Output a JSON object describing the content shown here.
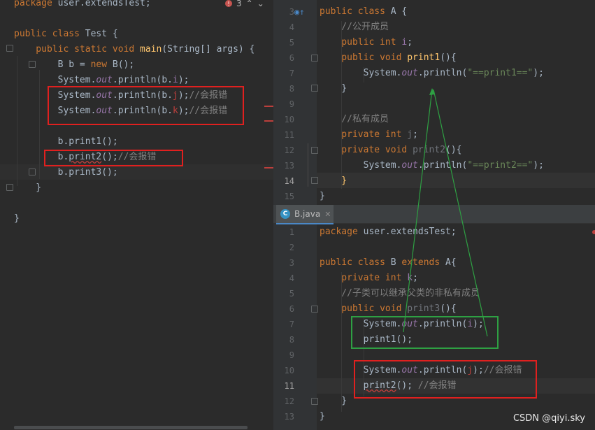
{
  "left": {
    "lines": [
      {
        "tokens": [
          {
            "t": "package ",
            "c": "kw"
          },
          {
            "t": "user.extendsTest;",
            "c": ""
          }
        ]
      },
      {
        "tokens": []
      },
      {
        "tokens": [
          {
            "t": "public class ",
            "c": "kw"
          },
          {
            "t": "Test {",
            "c": ""
          }
        ]
      },
      {
        "tokens": [
          {
            "t": "    public static void ",
            "c": "kw"
          },
          {
            "t": "main",
            "c": "fn"
          },
          {
            "t": "(String[] args) {",
            "c": ""
          }
        ]
      },
      {
        "tokens": [
          {
            "t": "        B b = ",
            "c": ""
          },
          {
            "t": "new ",
            "c": "kw"
          },
          {
            "t": "B();",
            "c": ""
          }
        ]
      },
      {
        "tokens": [
          {
            "t": "        System.",
            "c": ""
          },
          {
            "t": "out",
            "c": "static"
          },
          {
            "t": ".println(b.",
            "c": ""
          },
          {
            "t": "i",
            "c": "field"
          },
          {
            "t": ");",
            "c": ""
          }
        ]
      },
      {
        "tokens": [
          {
            "t": "        System.",
            "c": ""
          },
          {
            "t": "out",
            "c": "static"
          },
          {
            "t": ".println(b.",
            "c": ""
          },
          {
            "t": "j",
            "c": "err"
          },
          {
            "t": ");",
            "c": ""
          },
          {
            "t": "//会报错",
            "c": "cmt"
          }
        ]
      },
      {
        "tokens": [
          {
            "t": "        System.",
            "c": ""
          },
          {
            "t": "out",
            "c": "static"
          },
          {
            "t": ".println(b.",
            "c": ""
          },
          {
            "t": "k",
            "c": "err"
          },
          {
            "t": ");",
            "c": ""
          },
          {
            "t": "//会报错",
            "c": "cmt"
          }
        ]
      },
      {
        "tokens": []
      },
      {
        "tokens": [
          {
            "t": "        b.print1();",
            "c": ""
          }
        ]
      },
      {
        "tokens": [
          {
            "t": "        b.",
            "c": ""
          },
          {
            "t": "print2",
            "c": "wavy"
          },
          {
            "t": "();",
            "c": ""
          },
          {
            "t": "//会报错",
            "c": "cmt"
          }
        ]
      },
      {
        "tokens": [
          {
            "t": "        b.print3();",
            "c": ""
          }
        ]
      },
      {
        "tokens": [
          {
            "t": "    }",
            "c": ""
          }
        ]
      },
      {
        "tokens": []
      },
      {
        "tokens": [
          {
            "t": "}",
            "c": ""
          }
        ]
      }
    ],
    "problems_count": "3"
  },
  "right_top": {
    "line_numbers": [
      "3",
      "4",
      "5",
      "6",
      "7",
      "8",
      "9",
      "10",
      "11",
      "12",
      "13",
      "14",
      "15"
    ],
    "current_line": "14",
    "lines": [
      {
        "tokens": [
          {
            "t": "public class ",
            "c": "kw"
          },
          {
            "t": "A {",
            "c": ""
          }
        ]
      },
      {
        "tokens": [
          {
            "t": "    //公开成员",
            "c": "cmt"
          }
        ]
      },
      {
        "tokens": [
          {
            "t": "    public int ",
            "c": "kw"
          },
          {
            "t": "i",
            "c": "field"
          },
          {
            "t": ";",
            "c": ""
          }
        ]
      },
      {
        "tokens": [
          {
            "t": "    public void ",
            "c": "kw"
          },
          {
            "t": "print1",
            "c": "fn"
          },
          {
            "t": "(){",
            "c": ""
          }
        ]
      },
      {
        "tokens": [
          {
            "t": "        System.",
            "c": ""
          },
          {
            "t": "out",
            "c": "static"
          },
          {
            "t": ".println(",
            "c": ""
          },
          {
            "t": "\"==print1==\"",
            "c": "str"
          },
          {
            "t": ");",
            "c": ""
          }
        ]
      },
      {
        "tokens": [
          {
            "t": "    }",
            "c": ""
          }
        ]
      },
      {
        "tokens": []
      },
      {
        "tokens": [
          {
            "t": "    //私有成员",
            "c": "cmt"
          }
        ]
      },
      {
        "tokens": [
          {
            "t": "    private int ",
            "c": "kw"
          },
          {
            "t": "j",
            "c": "dim"
          },
          {
            "t": ";",
            "c": ""
          }
        ]
      },
      {
        "tokens": [
          {
            "t": "    private void ",
            "c": "kw"
          },
          {
            "t": "print2",
            "c": "dim"
          },
          {
            "t": "(){",
            "c": ""
          }
        ]
      },
      {
        "tokens": [
          {
            "t": "        System.",
            "c": ""
          },
          {
            "t": "out",
            "c": "static"
          },
          {
            "t": ".println(",
            "c": ""
          },
          {
            "t": "\"==print2==\"",
            "c": "str"
          },
          {
            "t": ");",
            "c": ""
          }
        ]
      },
      {
        "tokens": [
          {
            "t": "    }",
            "c": "fn"
          }
        ]
      },
      {
        "tokens": [
          {
            "t": "}",
            "c": ""
          }
        ]
      }
    ]
  },
  "right_bottom": {
    "tab_label": "B.java",
    "tab_icon_letter": "C",
    "line_numbers": [
      "1",
      "2",
      "3",
      "4",
      "5",
      "6",
      "7",
      "8",
      "9",
      "10",
      "11",
      "12",
      "13"
    ],
    "current_line": "11",
    "lines": [
      {
        "tokens": [
          {
            "t": "package ",
            "c": "kw"
          },
          {
            "t": "user.extendsTest;",
            "c": ""
          }
        ]
      },
      {
        "tokens": []
      },
      {
        "tokens": [
          {
            "t": "public class ",
            "c": "kw"
          },
          {
            "t": "B ",
            "c": ""
          },
          {
            "t": "extends ",
            "c": "kw"
          },
          {
            "t": "A{",
            "c": ""
          }
        ]
      },
      {
        "tokens": [
          {
            "t": "    private int ",
            "c": "kw"
          },
          {
            "t": "k",
            "c": "field"
          },
          {
            "t": ";",
            "c": ""
          }
        ]
      },
      {
        "tokens": [
          {
            "t": "    //子类可以继承父类的非私有成员",
            "c": "cmt"
          }
        ]
      },
      {
        "tokens": [
          {
            "t": "    public void ",
            "c": "kw"
          },
          {
            "t": "print3",
            "c": "dim"
          },
          {
            "t": "(){",
            "c": ""
          }
        ]
      },
      {
        "tokens": [
          {
            "t": "        System.",
            "c": ""
          },
          {
            "t": "out",
            "c": "static"
          },
          {
            "t": ".println(",
            "c": ""
          },
          {
            "t": "i",
            "c": "field"
          },
          {
            "t": ");",
            "c": ""
          }
        ]
      },
      {
        "tokens": [
          {
            "t": "        print1();",
            "c": ""
          }
        ]
      },
      {
        "tokens": []
      },
      {
        "tokens": [
          {
            "t": "        System.",
            "c": ""
          },
          {
            "t": "out",
            "c": "static"
          },
          {
            "t": ".println(",
            "c": ""
          },
          {
            "t": "j",
            "c": "err"
          },
          {
            "t": ");",
            "c": ""
          },
          {
            "t": "//会报错",
            "c": "cmt"
          }
        ]
      },
      {
        "tokens": [
          {
            "t": "        ",
            "c": ""
          },
          {
            "t": "print2",
            "c": "wavy"
          },
          {
            "t": "(); ",
            "c": ""
          },
          {
            "t": "//会报错",
            "c": "cmt"
          }
        ]
      },
      {
        "tokens": [
          {
            "t": "    }",
            "c": ""
          }
        ]
      },
      {
        "tokens": [
          {
            "t": "}",
            "c": ""
          }
        ]
      }
    ]
  },
  "watermark": "CSDN @qiyi.sky",
  "colors": {
    "error_box": "#e0201f",
    "ok_box": "#2ea043",
    "arrow": "#2ea043"
  }
}
